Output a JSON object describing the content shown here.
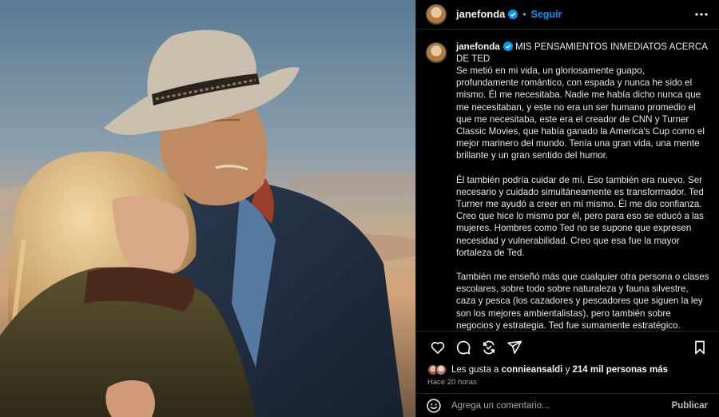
{
  "post": {
    "username": "janefonda",
    "verified": true,
    "follow_label": "Seguir",
    "separator": "•",
    "caption_title": "MIS PENSAMIENTOS INMEDIATOS ACERCA DE TED",
    "caption_paragraphs": [
      "Se metió en mi vida, un gloriosamente guapo, profundamente romántico, con espada y nunca he sido el mismo. Él me necesitaba. Nadie me había dicho nunca que me necesitaban, y este no era un ser humano promedio el que me necesitaba, este era el creador de CNN y Turner Classic Movies, que había ganado la America's Cup como el mejor marinero del mundo. Tenía una gran vida, una mente brillante y un gran sentido del humor.",
      "Él también podría cuidar de mí. Eso también era nuevo. Ser necesario y cuidado simultáneamente es transformador. Ted Turner me ayudó a creer en mí mismo. Él me dio confianza. Creo que hice lo mismo por él, pero para eso se educó a las mujeres. Hombres como Ted no se supone que expresen necesidad y vulnerabilidad. Creo que esa fue la mayor fortaleza de Ted.",
      "También me enseñó más que cualquier otra persona o clases escolares, sobre todo sobre naturaleza y fauna silvestre, caza y pesca (los cazadores y pescadores que siguen la ley son los mejores ambientalistas), pero también sobre negocios y estrategia. Ted fue sumamente estratégico. Probablemente era innato, pero estudió a los Clásicos en la universidad, sabía sobre la Guerra Peleponesia por dentro y por fuera y las estrategias utilizadas por Alejandro Magno e incluso Genghis Khan. Y"
    ],
    "likes_prefix": "Les gusta a",
    "likes_user": "connieansaldi",
    "likes_connector": "y",
    "likes_others": "214 mil personas más",
    "time_ago": "Hace 20 horas",
    "comment_placeholder": "Agrega un comentario...",
    "publish_label": "Publicar"
  },
  "icons": {
    "more": "more-horizontal-icon",
    "like": "heart-icon",
    "comment": "comment-bubble-icon",
    "share": "repost-icon",
    "send": "paper-plane-icon",
    "save": "bookmark-icon",
    "emoji": "emoji-icon",
    "verified": "verified-badge-icon"
  },
  "colors": {
    "background": "#000000",
    "text": "#f5f5f5",
    "secondary": "#a8a8a8",
    "accent": "#0095f6",
    "verified": "#0095f6",
    "divider": "#262626"
  }
}
